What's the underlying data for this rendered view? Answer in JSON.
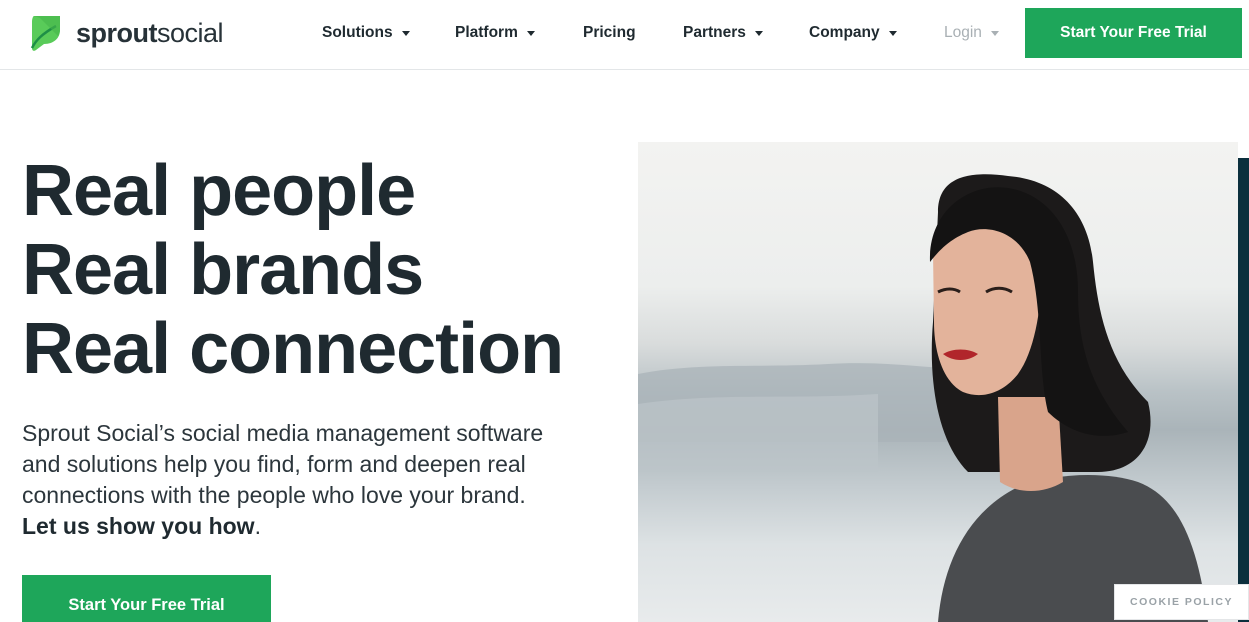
{
  "brand": {
    "name_bold": "sprout",
    "name_regular": "social",
    "accent": "#1ea65a",
    "logo_leaf": "#59cb59"
  },
  "nav": {
    "items": [
      {
        "label": "Solutions",
        "dropdown": true
      },
      {
        "label": "Platform",
        "dropdown": true
      },
      {
        "label": "Pricing",
        "dropdown": false
      },
      {
        "label": "Partners",
        "dropdown": true
      },
      {
        "label": "Company",
        "dropdown": true
      },
      {
        "label": "Login",
        "dropdown": true
      }
    ],
    "cta_label": "Start Your Free Trial"
  },
  "hero": {
    "headline": [
      "Real people",
      "Real brands",
      "Real connection"
    ],
    "body": "Sprout Social’s social media management software and solutions help you find, form and deepen real connections with the people who love your brand.",
    "body_strong": "Let us show you how",
    "body_end": ".",
    "cta_label": "Start Your Free Trial"
  },
  "cookie": {
    "label": "COOKIE POLICY"
  },
  "icons": [
    "sprout-leaf-logo-icon",
    "chevron-down-icon"
  ]
}
